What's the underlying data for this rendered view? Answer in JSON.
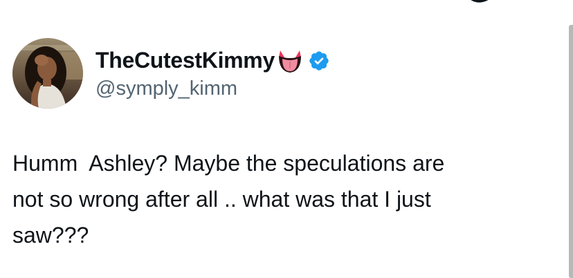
{
  "tweet": {
    "author": {
      "display_name": "TheCutestKimmy",
      "handle": "@symply_kimm",
      "name_emoji": "tongue-out-devil-emoji",
      "verified": true,
      "verified_color": "#1d9bf0"
    },
    "text_lines": [
      "Humm  Ashley? Maybe the speculations are",
      "not so wrong after all .. what was that I just",
      "saw???"
    ]
  },
  "colors": {
    "text_primary": "#0f1419",
    "text_secondary": "#536471",
    "accent": "#1d9bf0",
    "scrollbar": "#b8b8b8"
  }
}
